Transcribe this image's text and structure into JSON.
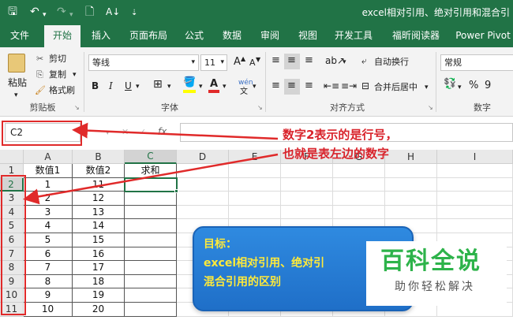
{
  "window": {
    "title": "excel相对引用、绝对引用和混合引"
  },
  "tabs": [
    "文件",
    "开始",
    "插入",
    "页面布局",
    "公式",
    "数据",
    "审阅",
    "视图",
    "开发工具",
    "福昕阅读器",
    "Power Pivot"
  ],
  "active_tab": "开始",
  "ribbon": {
    "clipboard": {
      "paste": "粘贴",
      "cut": "剪切",
      "copy": "复制",
      "format_painter": "格式刷",
      "group": "剪贴板"
    },
    "font": {
      "font_name": "等线",
      "font_size": "11",
      "group": "字体",
      "bold": "B",
      "italic": "I",
      "underline": "U",
      "grow": "A",
      "shrink": "A",
      "wen": "wén"
    },
    "alignment": {
      "wrap_text": "自动换行",
      "merge_center": "合并后居中",
      "group": "对齐方式"
    },
    "number": {
      "format": "常规",
      "percent": "%",
      "comma": "9",
      "group": "数字"
    }
  },
  "formula_bar": {
    "name_box": "C2",
    "fx": "fx",
    "content": ""
  },
  "columns": [
    "A",
    "B",
    "C",
    "D",
    "E",
    "F",
    "G",
    "H",
    "I"
  ],
  "rows": [
    "1",
    "2",
    "3",
    "4",
    "5",
    "6",
    "7",
    "8",
    "9",
    "10",
    "11"
  ],
  "table": {
    "headers": [
      "数值1",
      "数值2",
      "求和"
    ],
    "rows": [
      [
        "1",
        "11",
        ""
      ],
      [
        "2",
        "12",
        ""
      ],
      [
        "3",
        "13",
        ""
      ],
      [
        "4",
        "14",
        ""
      ],
      [
        "5",
        "15",
        ""
      ],
      [
        "6",
        "16",
        ""
      ],
      [
        "7",
        "17",
        ""
      ],
      [
        "8",
        "18",
        ""
      ],
      [
        "9",
        "19",
        ""
      ],
      [
        "10",
        "20",
        ""
      ]
    ]
  },
  "annotation": {
    "line1": "数字2表示的是行号，",
    "line2": "也就是表左边的数字"
  },
  "callout": {
    "line1": "目标：",
    "line2": "excel相对引用、绝对引",
    "line3": "混合引用的区别"
  },
  "watermark": {
    "title": "百科全说",
    "subtitle": "助你轻松解决"
  },
  "colors": {
    "excel_green": "#217346",
    "annotation_red": "#d9232b",
    "callout_blue": "#2f8ae0",
    "callout_text": "#ffea3a",
    "watermark_green": "#2db34a"
  }
}
